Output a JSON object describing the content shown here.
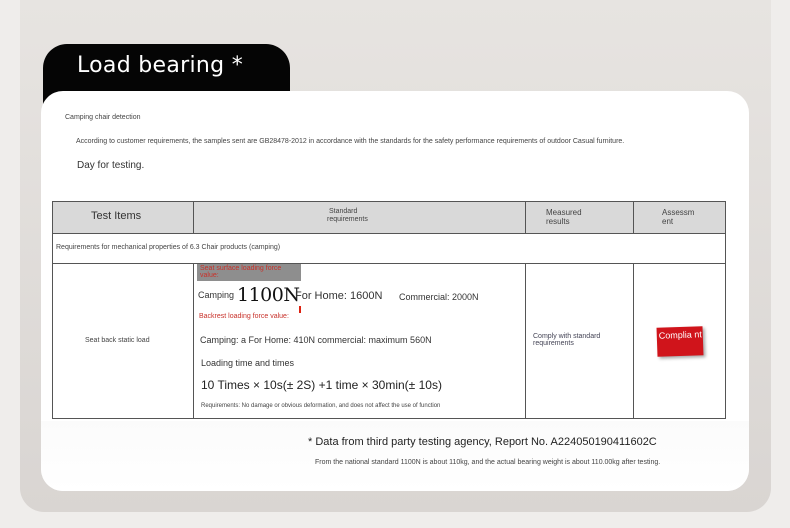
{
  "header": {
    "title": "Load bearing *"
  },
  "intro": {
    "detection": "Camping chair detection",
    "statement": "According to customer requirements, the samples sent are GB28478-2012 in accordance with the standards for the safety performance requirements of outdoor Casual furniture.",
    "day": "Day for testing."
  },
  "table": {
    "headers": {
      "test_items": "Test Items",
      "standard_line1": "Standard",
      "standard_line2": "requirements",
      "measured_line1": "Measured",
      "measured_line2": "results",
      "assessment_line1": "Assessm",
      "assessment_line2": "ent"
    },
    "section_row": "Requirements for mechanical properties of 6.3 Chair products (camping)",
    "row": {
      "test_item": "Seat back static load",
      "seat_label_line1": "Seat surface loading force",
      "seat_label_line2": "value:",
      "camping_label": "Camping",
      "camping_value": "1100N",
      "for_home": "For Home: 1600N",
      "commercial": "Commercial: 2000N",
      "backrest_label": "Backrest loading force value:",
      "backrest_values": "Camping: a For Home: 410N commercial: maximum 560N",
      "loading_label": "Loading time and times",
      "times_value": "10 Times × 10s(± 2S) +1 time × 30min(± 10s)",
      "requirements": "Requirements: No damage or obvious deformation, and does not affect the use of function",
      "measured_line1": "Comply with standard",
      "measured_line2": "requirements",
      "assessment": "Complia nt"
    }
  },
  "footer": {
    "data_from": "* Data from third party testing agency, Report No. A224050190411602C",
    "national": "From the national standard 1100N is about 110kg, and the actual bearing weight is about 110.00kg after testing."
  },
  "colors": {
    "tab": "#050505",
    "badge": "#d0141b",
    "label_red": "#c8312a",
    "header_gray": "#d9d9d9"
  }
}
